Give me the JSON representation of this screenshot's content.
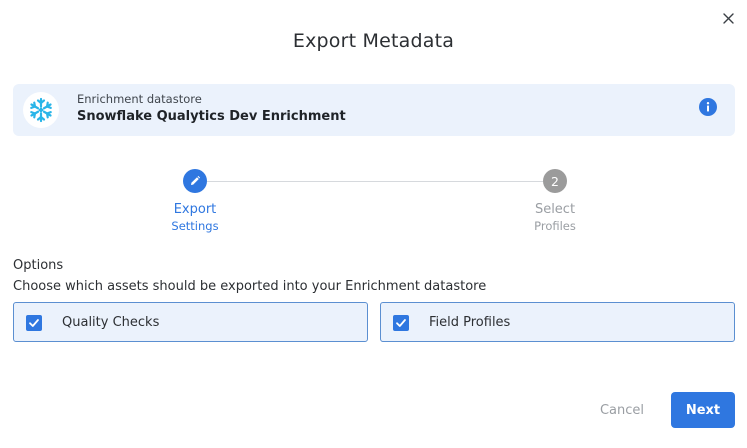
{
  "dialog": {
    "title": "Export Metadata",
    "close_icon": "close-icon"
  },
  "datastore": {
    "label": "Enrichment datastore",
    "name": "Snowflake Qualytics Dev Enrichment",
    "logo_icon": "snowflake-icon",
    "info_icon": "info-icon"
  },
  "stepper": {
    "steps": [
      {
        "number": "",
        "title": "Export",
        "subtitle": "Settings",
        "status": "active",
        "icon": "pencil-icon"
      },
      {
        "number": "2",
        "title": "Select",
        "subtitle": "Profiles",
        "status": "inactive"
      }
    ]
  },
  "options": {
    "title": "Options",
    "description": "Choose which assets should be exported into your Enrichment datastore",
    "items": [
      {
        "label": "Quality Checks",
        "checked": true
      },
      {
        "label": "Field Profiles",
        "checked": true
      }
    ]
  },
  "footer": {
    "cancel_label": "Cancel",
    "next_label": "Next"
  },
  "colors": {
    "accent": "#2f77e0",
    "card_background": "#ebf2fc",
    "snowflake": "#29b5e8",
    "inactive_step": "#9b9b9b"
  }
}
